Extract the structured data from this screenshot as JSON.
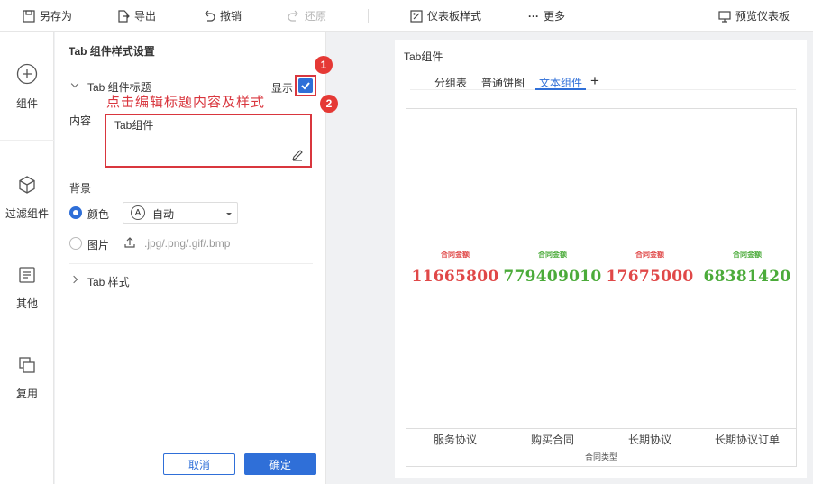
{
  "toolbar": {
    "save_as": "另存为",
    "export": "导出",
    "undo": "撤销",
    "redo": "还原",
    "dashboard_style": "仪表板样式",
    "more": "更多",
    "preview": "预览仪表板"
  },
  "leftnav": {
    "items": [
      {
        "label": "组件",
        "icon": "plus-circle-icon"
      },
      {
        "label": "过滤组件",
        "icon": "cube-icon"
      },
      {
        "label": "其他",
        "icon": "doc-icon"
      },
      {
        "label": "复用",
        "icon": "stack-icon"
      }
    ]
  },
  "panel": {
    "title": "Tab 组件样式设置",
    "tab_title_section": "Tab 组件标题",
    "show_label": "显示",
    "show_checked": true,
    "annotation": "点击编辑标题内容及样式",
    "badge1": "1",
    "badge2": "2",
    "content_label": "内容",
    "content_value": "Tab组件",
    "background_label": "背景",
    "color_label": "颜色",
    "color_select_icon": "A",
    "color_select_value": "自动",
    "image_label": "图片",
    "image_hint": ".jpg/.png/.gif/.bmp",
    "tab_style_section": "Tab 样式",
    "cancel": "取消",
    "confirm": "确定"
  },
  "widget": {
    "title": "Tab组件",
    "tabs": [
      {
        "label": "分组表",
        "active": false
      },
      {
        "label": "普通饼图",
        "active": false
      },
      {
        "label": "文本组件",
        "active": true
      }
    ],
    "add_tab_glyph": "+"
  },
  "chart_data": {
    "type": "table",
    "categories": [
      "服务协议",
      "购买合同",
      "长期协议",
      "长期协议订单"
    ],
    "series": [
      {
        "name": "合同金额",
        "values": [
          11665800,
          779409010,
          17675000,
          68381420
        ]
      }
    ],
    "value_labels": [
      "11665800",
      "779409010",
      "17675000",
      "68381420"
    ],
    "label_text": "合同金额",
    "colors": [
      "#e04848",
      "#4bab3a",
      "#e04848",
      "#4bab3a"
    ],
    "xlabel": "合同类型",
    "ylabel": ""
  }
}
